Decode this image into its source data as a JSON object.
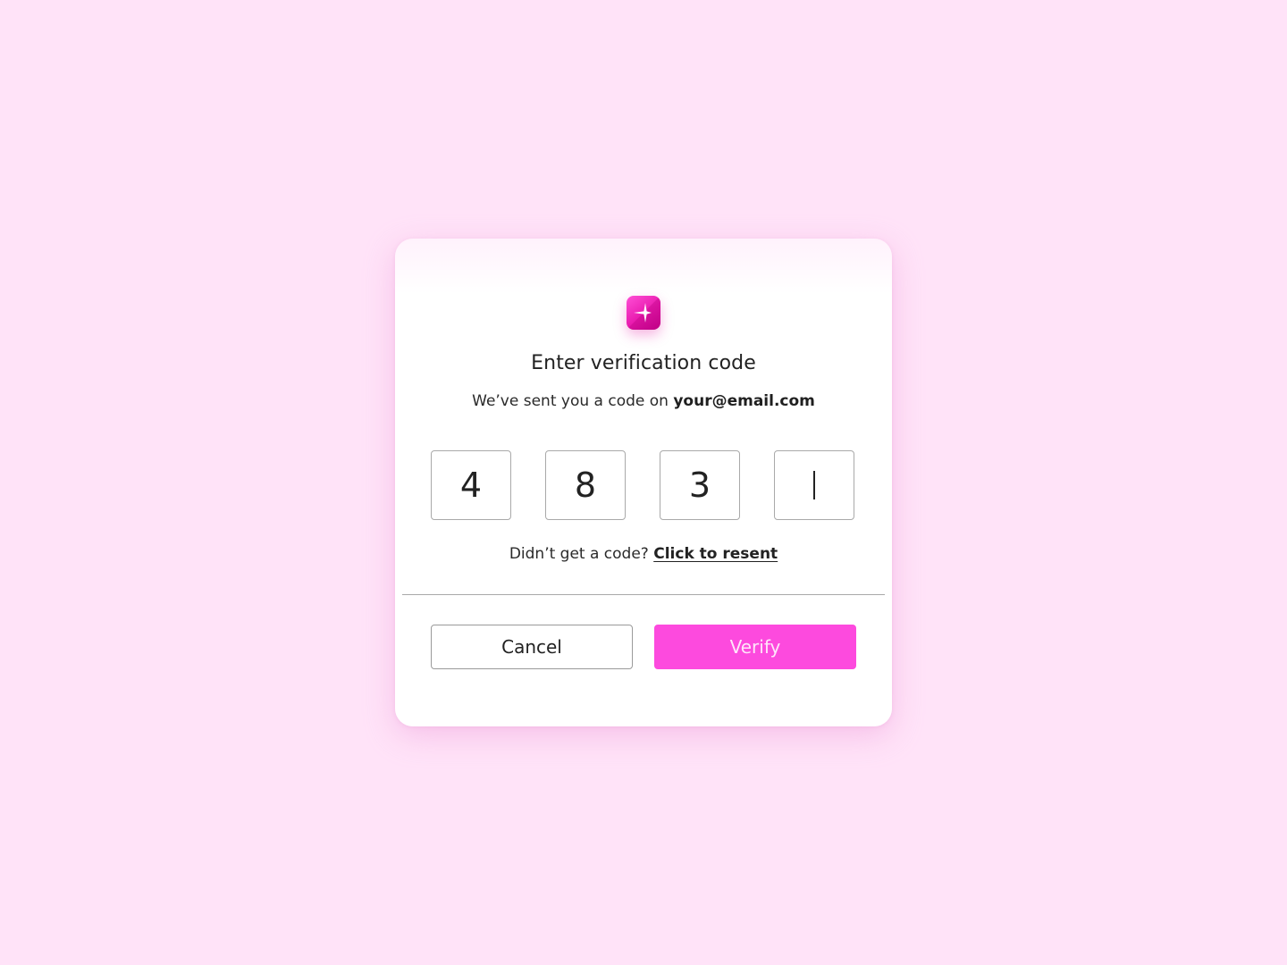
{
  "colors": {
    "page_background": "#ffe3f8",
    "brand_pink": "#fd4ade",
    "card_background": "#ffffff"
  },
  "logo": {
    "icon": "sparkle-logo-icon"
  },
  "dialog": {
    "title": "Enter verification code",
    "subtitle_prefix": "We’ve sent you a code on",
    "email": "your@email.com"
  },
  "code_inputs": [
    {
      "value": "4"
    },
    {
      "value": "8"
    },
    {
      "value": "3"
    },
    {
      "value": "",
      "focused": true
    }
  ],
  "resend": {
    "prompt": "Didn’t get a code?",
    "link_label": "Click to resent"
  },
  "actions": {
    "cancel_label": "Cancel",
    "verify_label": "Verify"
  }
}
